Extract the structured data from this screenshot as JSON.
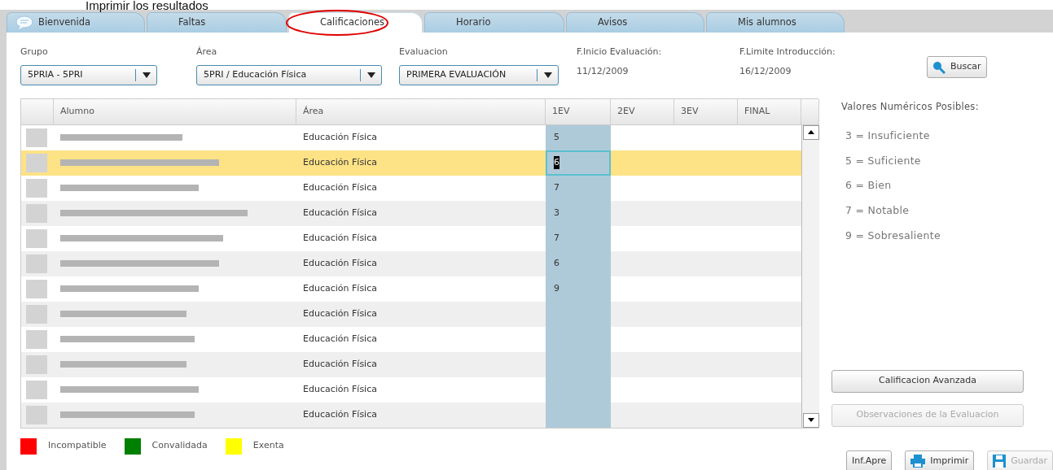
{
  "page_heading": "Imprimir los resultados",
  "tabs": [
    {
      "label": "Bienvenida",
      "selected": false,
      "circled": false
    },
    {
      "label": "Faltas",
      "selected": false,
      "circled": false
    },
    {
      "label": "Calificaciones",
      "selected": true,
      "circled": true
    },
    {
      "label": "Horario",
      "selected": false,
      "circled": false
    },
    {
      "label": "Avisos",
      "selected": false,
      "circled": false
    },
    {
      "label": "Mis alumnos",
      "selected": false,
      "circled": false
    }
  ],
  "filters": [
    {
      "label": "Grupo",
      "value": "5PRIA - 5PRI"
    },
    {
      "label": "Área",
      "value": "5PRI / Educación Física"
    },
    {
      "label": "Evaluacion",
      "value": "PRIMERA EVALUACIÓN"
    }
  ],
  "dates": [
    {
      "label": "F.Inicio Evaluación:",
      "value": "11/12/2009"
    },
    {
      "label": "F.Limite Introducción:",
      "value": "16/12/2009"
    }
  ],
  "search_button": "Buscar",
  "table": {
    "columns": [
      "Alumno",
      "Área",
      "1EV",
      "2EV",
      "3EV",
      "FINAL"
    ],
    "rows": [
      {
        "area": "Educación Física",
        "grade_1ev": "5",
        "selected": false
      },
      {
        "area": "Educación Física",
        "grade_1ev": "6",
        "selected": true
      },
      {
        "area": "Educación Física",
        "grade_1ev": "7",
        "selected": false
      },
      {
        "area": "Educación Física",
        "grade_1ev": "3",
        "selected": false
      },
      {
        "area": "Educación Física",
        "grade_1ev": "7",
        "selected": false
      },
      {
        "area": "Educación Física",
        "grade_1ev": "6",
        "selected": false
      },
      {
        "area": "Educación Física",
        "grade_1ev": "9",
        "selected": false
      },
      {
        "area": "Educación Física",
        "selected": false
      },
      {
        "area": "Educación Física",
        "selected": false
      },
      {
        "area": "Educación Física",
        "selected": false
      },
      {
        "area": "Educación Física",
        "selected": false
      },
      {
        "area": "Educación Física",
        "selected": false
      }
    ]
  },
  "legend": [
    {
      "label": "Incompatible",
      "color": "#ff0000"
    },
    {
      "label": "Convalidada",
      "color": "#008000"
    },
    {
      "label": "Exenta",
      "color": "#ffff00"
    }
  ],
  "valid_values": {
    "title": "Valores Numéricos Posibles:",
    "items": [
      "3 = Insuficiente",
      "5 = Suficiente",
      "6 = Bien",
      "7 = Notable",
      "9 = Sobresaliente"
    ]
  },
  "side_buttons": [
    {
      "label": "Calificacion Avanzada",
      "disabled": false
    },
    {
      "label": "Observaciones de la Evaluacion",
      "disabled": true
    }
  ],
  "bottom_buttons": [
    {
      "label": "Inf.Apre",
      "kind": "text",
      "disabled": false
    },
    {
      "label": "Imprimir",
      "kind": "print",
      "disabled": false
    },
    {
      "label": "Guardar",
      "kind": "save",
      "disabled": true
    }
  ]
}
